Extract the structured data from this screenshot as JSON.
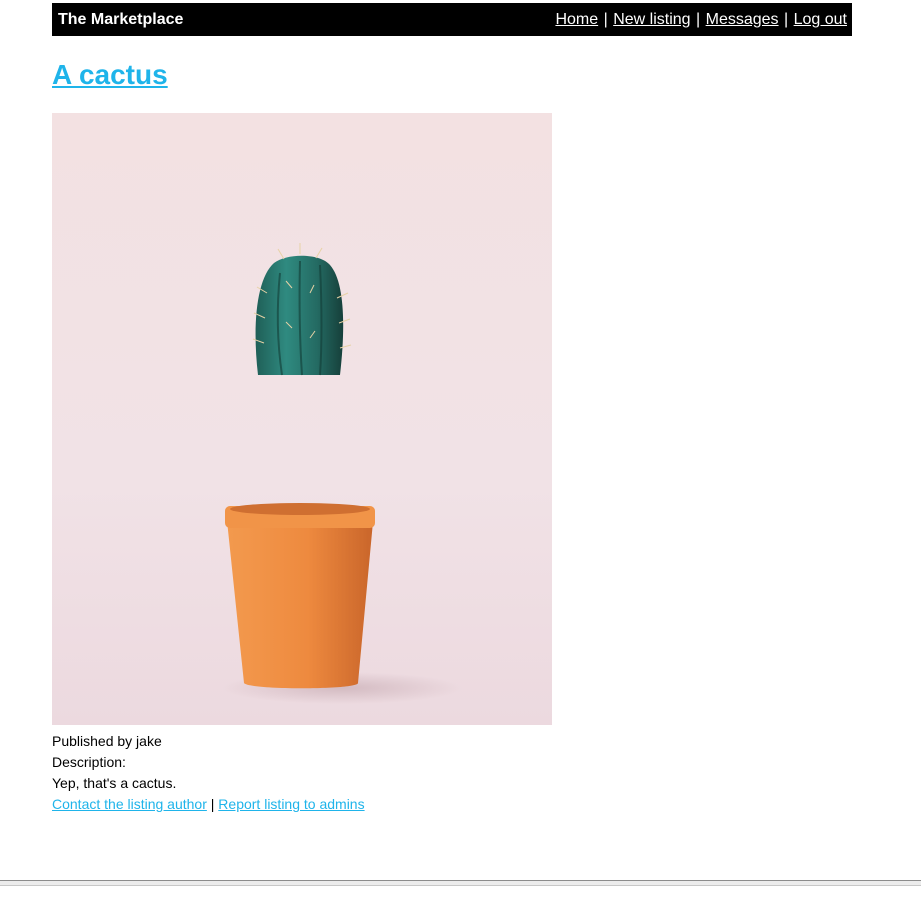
{
  "app": {
    "brand": "The Marketplace",
    "nav": [
      {
        "label": "Home"
      },
      {
        "label": "New listing"
      },
      {
        "label": "Messages"
      },
      {
        "label": "Log out"
      }
    ],
    "separator": "|"
  },
  "listing": {
    "title": "A cactus",
    "image_alt": "Potted cactus on pink background",
    "published_by": "Published by jake",
    "description_label": "Description:",
    "description": "Yep, that's a cactus.",
    "actions": {
      "contact": "Contact the listing author",
      "separator": "|",
      "report": "Report listing to admins"
    }
  },
  "colors": {
    "link": "#1fb4ea",
    "navbar_bg": "#000000",
    "pot": "#ee8a3f",
    "cactus": "#2c7a6e",
    "photo_bg": "#f2e3e6"
  }
}
